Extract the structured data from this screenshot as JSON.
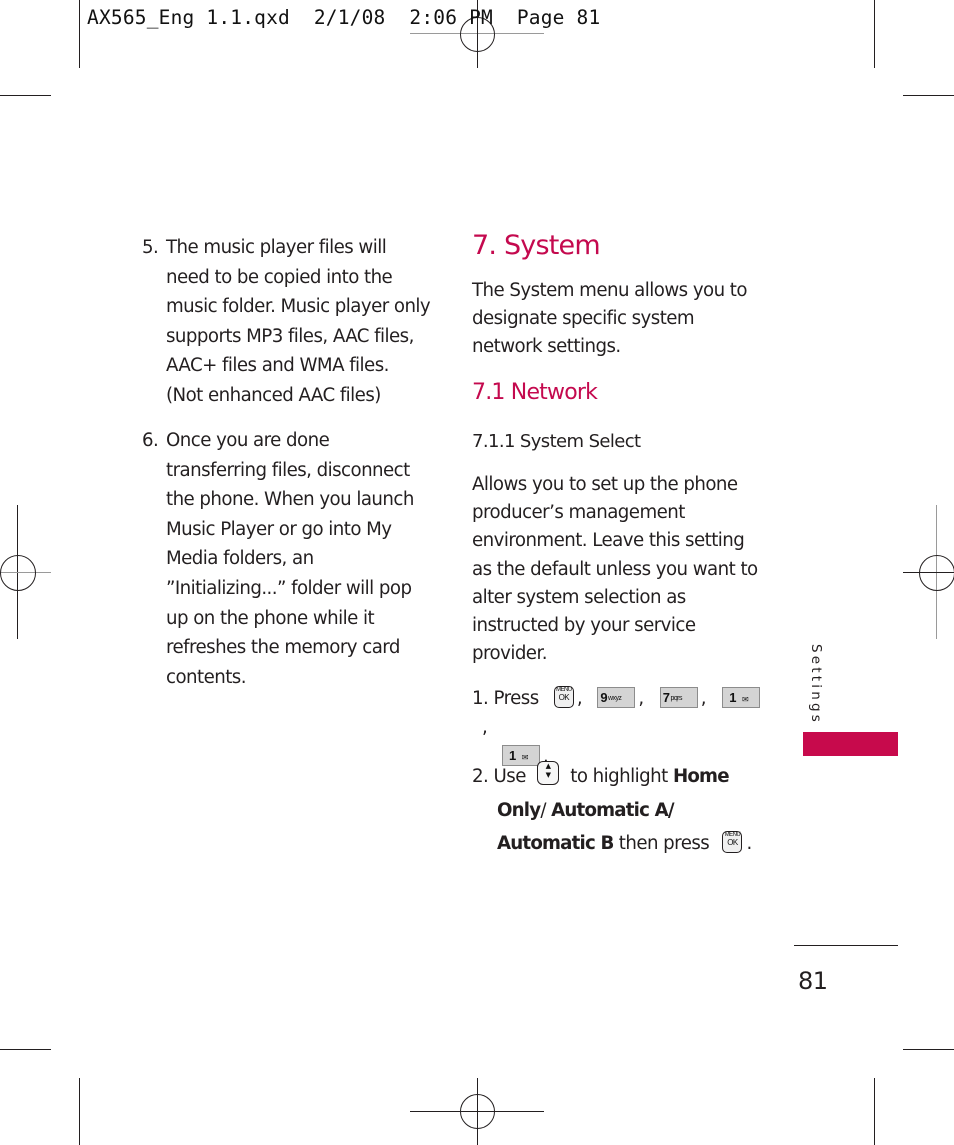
{
  "slug": {
    "text": "AX565_Eng 1.1.qxd  2/1/08  2:06 PM  Page 81"
  },
  "left_column": {
    "items": [
      {
        "number": "5.",
        "lines": [
          "The music player files will",
          "need to be copied into the",
          "music folder. Music player only",
          "supports MP3 files, AAC files,",
          "AAC+ files and WMA files.",
          "(Not enhanced AAC files)"
        ]
      },
      {
        "number": "6.",
        "lines": [
          "Once you are done",
          "transferring files, disconnect",
          "the phone. When you launch",
          "Music Player or go into My",
          "Media folders, an",
          "”Initializing...” folder will pop",
          "up on the phone while it",
          "refreshes the memory card",
          "contents."
        ]
      }
    ]
  },
  "right_column": {
    "section_title": "7. System",
    "section_intro": [
      "The System menu allows you to",
      "designate specific system",
      "network settings."
    ],
    "subsection_title": "7.1 Network",
    "subsubsection_title": "7.1.1 System Select",
    "description": [
      "Allows you to set up the phone",
      "producer’s management",
      "environment. Leave this setting",
      "as the default unless you want to",
      "alter system selection as",
      "instructed by your service",
      "provider."
    ],
    "step1": {
      "number": "1.",
      "label": "Press",
      "keys": [
        {
          "type": "menu-ok",
          "top": "MENU",
          "bottom": "OK"
        },
        {
          "type": "digit",
          "digit": "9",
          "letters": "wxyz"
        },
        {
          "type": "digit",
          "digit": "7",
          "letters": "pqrs"
        },
        {
          "type": "digit",
          "digit": "1",
          "letters": "voicemail"
        },
        {
          "type": "digit",
          "digit": "1",
          "letters": "voicemail"
        }
      ],
      "separator": ",",
      "end": "."
    },
    "step2": {
      "number": "2.",
      "label_use": "Use",
      "label_highlight": "to highlight",
      "option_home": "Home",
      "option_only": "Only",
      "slash": "/",
      "option_auto_a": "Automatic A",
      "option_auto_b": "Automatic B",
      "label_then": "then press",
      "end": "."
    }
  },
  "sidebar": {
    "section_label": "Settings",
    "accent_color": "#c70a4c"
  },
  "footer": {
    "page_number": "81"
  },
  "colors": {
    "heading": "#c4094e",
    "text": "#231f20"
  }
}
